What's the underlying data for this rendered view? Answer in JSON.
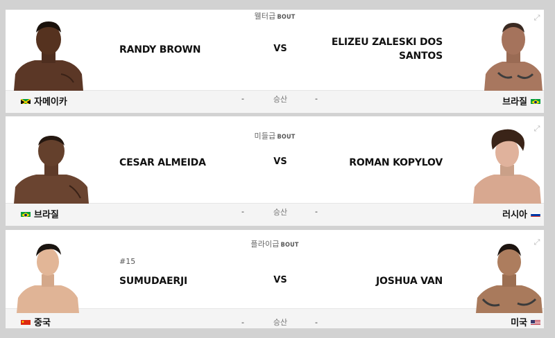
{
  "bouts": [
    {
      "weight_class": "웰터급",
      "bout_label": "BOUT",
      "red": {
        "name_line1": "RANDY BROWN",
        "name_line2": "",
        "country": "자메이카",
        "flag": "jamaica"
      },
      "blue": {
        "name_line1": "ELIZEU ZALESKI DOS",
        "name_line2": "SANTOS",
        "country": "브라질",
        "flag": "brazil"
      },
      "vs": "VS",
      "result_left": "-",
      "method": "승산",
      "result_right": "-"
    },
    {
      "weight_class": "미들급",
      "bout_label": "BOUT",
      "red": {
        "name_line1": "CESAR ALMEIDA",
        "name_line2": "",
        "country": "브라질",
        "flag": "brazil"
      },
      "blue": {
        "name_line1": "ROMAN KOPYLOV",
        "name_line2": "",
        "country": "러시아",
        "flag": "russia"
      },
      "vs": "VS",
      "result_left": "-",
      "method": "승산",
      "result_right": "-"
    },
    {
      "weight_class": "플라이급",
      "bout_label": "BOUT",
      "red": {
        "rank": "#15",
        "name_line1": "SUMUDAERJI",
        "name_line2": "",
        "country": "중국",
        "flag": "china"
      },
      "blue": {
        "name_line1": "JOSHUA VAN",
        "name_line2": "",
        "country": "미국",
        "flag": "usa"
      },
      "vs": "VS",
      "result_left": "-",
      "method": "승산",
      "result_right": "-"
    }
  ],
  "icons": {
    "expand": "expand-icon"
  }
}
